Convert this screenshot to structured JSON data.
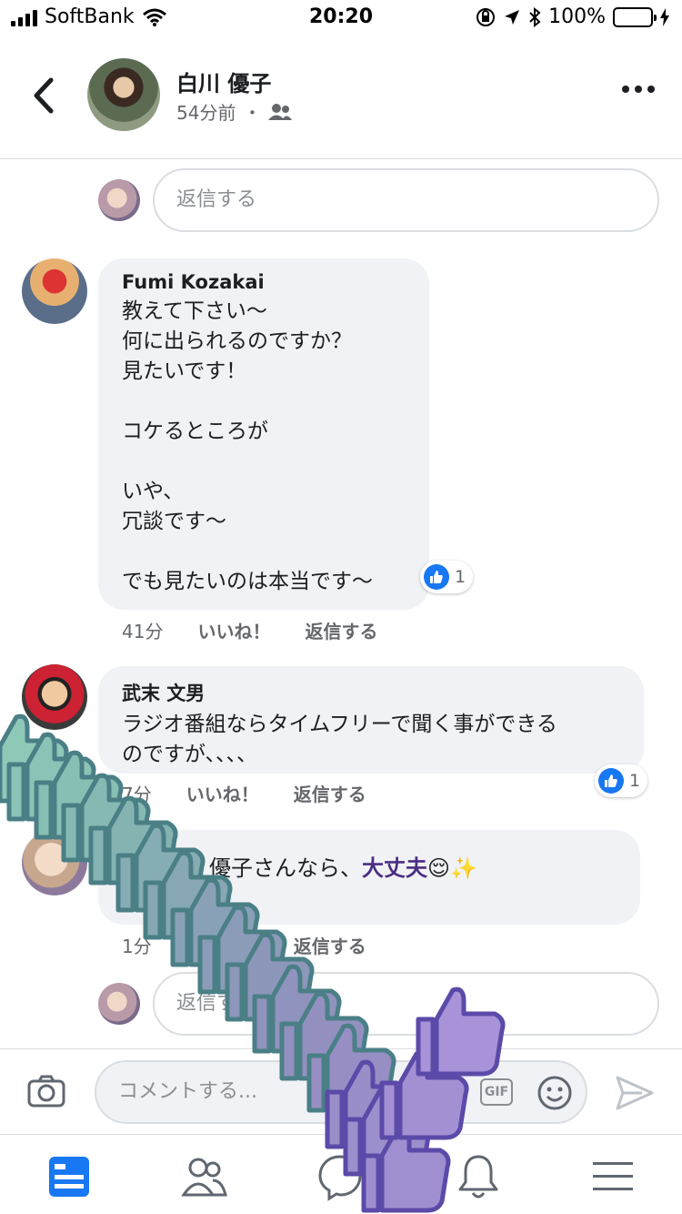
{
  "status": {
    "carrier": "SoftBank",
    "time": "20:20",
    "battery": "100%"
  },
  "header": {
    "name": "白川 優子",
    "time": "54分前",
    "dot": "・"
  },
  "reply_placeholder": "返信する",
  "comments": [
    {
      "author": "Fumi Kozakai",
      "lines": [
        "教えて下さい〜",
        "何に出られるのですか？",
        "見たいです！",
        "",
        "コケるところが",
        "",
        "いや、",
        "冗談です〜",
        "",
        "でも見たいのは本当です〜"
      ],
      "reactions": "1",
      "time": "41分",
      "like_label": "いいね！",
      "reply_label": "返信する"
    },
    {
      "author": "武末 文男",
      "lines": [
        "ラジオ番組ならタイムフリーで聞く事ができる",
        "のですが、、、、"
      ],
      "reactions": "1",
      "time": "7分",
      "like_label": "いいね！",
      "reply_label": "返信する"
    },
    {
      "author": "",
      "parts": [
        "大丈夫",
        "、優子さんなら、",
        "大丈夫",
        "😌✨"
      ],
      "time": "1分",
      "like_label": "いいね！",
      "reply_label": "返信する"
    }
  ],
  "composer": {
    "placeholder": "コメントする...",
    "gif": "GIF"
  },
  "tabs": [
    "news-feed",
    "friends",
    "messenger",
    "notifications",
    "menu"
  ],
  "colors": {
    "accent": "#1877f2",
    "bubble": "#f0f2f5",
    "highlight": "#4b2e83",
    "thumb_purple": "#9b8fd6",
    "thumb_teal": "#7fb8a6"
  }
}
